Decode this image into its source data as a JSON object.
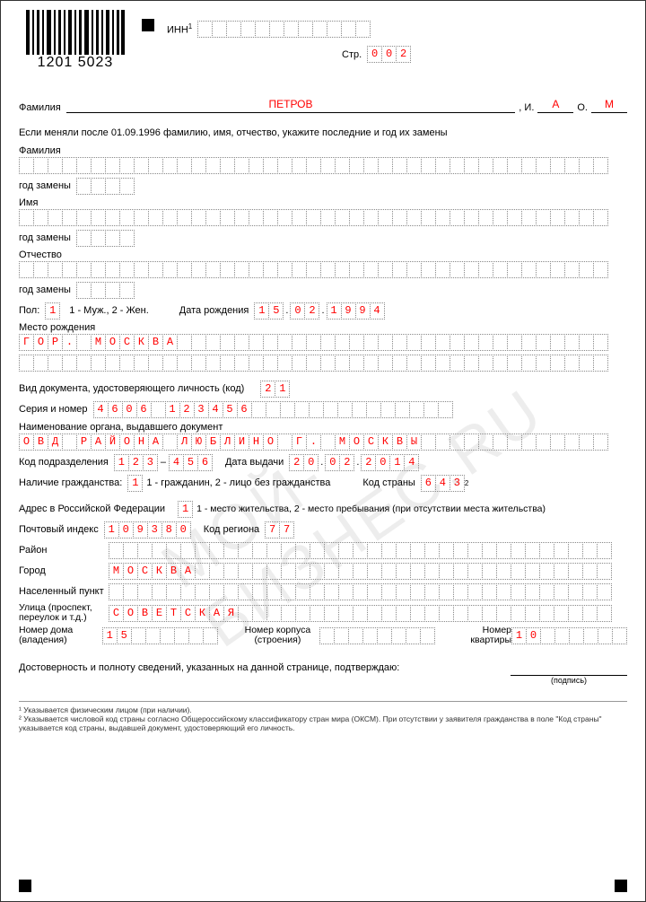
{
  "barcode_num": "1201 5023",
  "inn_label": "ИНН",
  "inn_cells": 12,
  "page_label": "Стр.",
  "page_value": "002",
  "famline": {
    "label": "Фамилия",
    "surname": "ПЕТРОВ",
    "i_label": ", И.",
    "i_val": "А",
    "o_label": "О.",
    "o_val": "М"
  },
  "change_hdr": "Если меняли после 01.09.1996 фамилию, имя, отчество, укажите последние и год их замены",
  "prev": {
    "fam_label": "Фамилия",
    "imya_label": "Имя",
    "otch_label": "Отчество",
    "year_label": "год замены",
    "cols": 41,
    "year_cols": 4
  },
  "sex": {
    "label": "Пол:",
    "val": "1",
    "hint": "1 - Муж., 2 - Жен."
  },
  "dob": {
    "label": "Дата рождения",
    "d": "15",
    "m": "02",
    "y": "1994"
  },
  "birthplace": {
    "label": "Место рождения",
    "line1": "ГОР. МОСКВА",
    "cols": 41
  },
  "doc_kind": {
    "label": "Вид документа, удостоверяющего личность (код)",
    "val": "21"
  },
  "doc_sn": {
    "label": "Серия и номер",
    "val": "4606 123456",
    "cols": 25
  },
  "issuer": {
    "label": "Наименование органа, выдавшего документ",
    "val": "ОВД РАЙОНА ЛЮБЛИНО Г. МОСКВЫ",
    "cols": 41
  },
  "dept": {
    "label": "Код подразделения",
    "a": "123",
    "b": "456"
  },
  "doc_date": {
    "label": "Дата выдачи",
    "d": "20",
    "m": "02",
    "y": "2014"
  },
  "citizen": {
    "label": "Наличие гражданства:",
    "val": "1",
    "hint": "1 - гражданин, 2 - лицо без гражданства",
    "country_label": "Код страны",
    "country_val": "643"
  },
  "addr_type": {
    "label": "Адрес в Российской Федерации",
    "val": "1",
    "hint": "1 - место жительства, 2 - место пребывания (при отсутствии места жительства)"
  },
  "zip": {
    "label": "Почтовый индекс",
    "val": "109380"
  },
  "region": {
    "label": "Код региона",
    "val": "77"
  },
  "district": {
    "label": "Район",
    "cols": 35
  },
  "city": {
    "label": "Город",
    "val": "МОСКВА",
    "cols": 35
  },
  "settlement": {
    "label": "Населенный пункт",
    "cols": 35
  },
  "street": {
    "label": "Улица (проспект, переулок и т.д.)",
    "val": "СОВЕТСКАЯ",
    "cols": 35
  },
  "house": {
    "label": "Номер дома (владения)",
    "val": "15",
    "cols": 8
  },
  "building": {
    "label": "Номер корпуса (строения)",
    "cols": 8
  },
  "flat": {
    "label": "Номер квартиры",
    "val": "10",
    "cols": 8
  },
  "confirm": "Достоверность и полноту сведений, указанных на данной странице, подтверждаю:",
  "signature": "(подпись)",
  "footnote1": "¹ Указывается физическим лицом (при наличии).",
  "footnote2": "² Указывается числовой код страны согласно Общероссийскому классификатору стран мира (ОКСМ). При отсутствии у заявителя гражданства в поле \"Код страны\" указывается код страны, выдавшей документ, удостоверяющий его личность.",
  "watermark": "МОЙ-БИЗНЕС.RU"
}
